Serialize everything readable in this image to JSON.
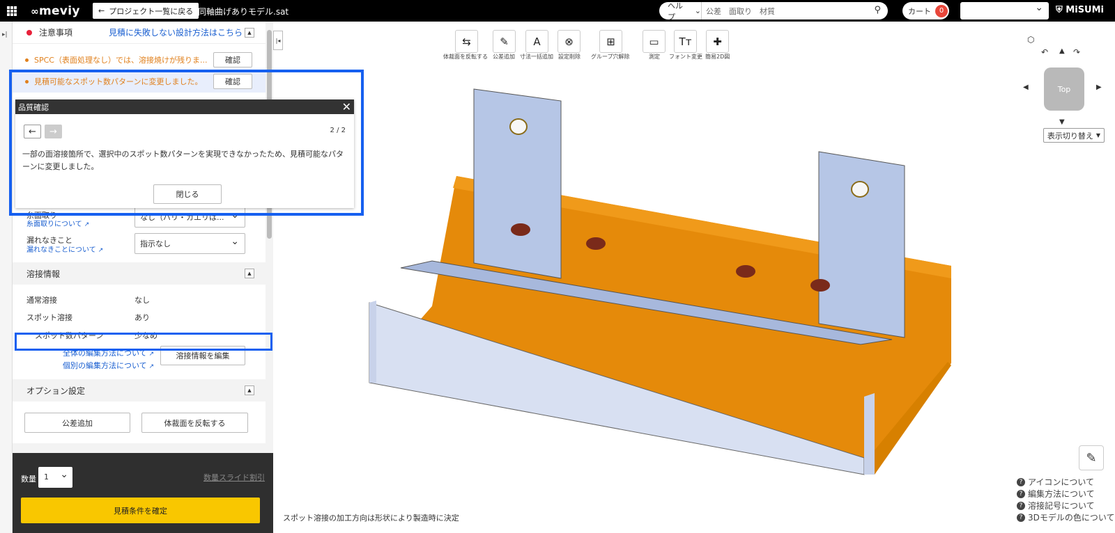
{
  "header": {
    "logo": "meviy",
    "back_label": "プロジェクト一覧に戻る",
    "file_name": "同軸曲げありモデル.sat",
    "help_label": "ヘルプ",
    "search_placeholder": "公差　面取り　材質",
    "cart_label": "カート",
    "cart_count": "0",
    "brand": "MiSUMi"
  },
  "notices": {
    "title": "注意事項",
    "title_link": "見積に失敗しない設計方法はこちら",
    "items": [
      {
        "text": "SPCC（表面処理なし）では、溶接焼けが残りま...",
        "button": "確認"
      },
      {
        "text": "見積可能なスポット数パターンに変更しました。",
        "button": "確認"
      }
    ]
  },
  "modal": {
    "title": "品質確認",
    "page": "2 / 2",
    "message": "一部の面溶接箇所で、選択中のスポット数パターンを実現できなかったため、見積可能なパターンに変更しました。",
    "close_label": "閉じる"
  },
  "fields": [
    {
      "label": "糸面取り",
      "link": "糸面取りについて",
      "value": "なし（バリ・カエリは..."
    },
    {
      "label": "漏れなきこと",
      "link": "漏れなきことについて",
      "value": "指示なし"
    }
  ],
  "welding": {
    "title": "溶接情報",
    "rows": [
      {
        "label": "通常溶接",
        "value": "なし"
      },
      {
        "label": "スポット溶接",
        "value": "あり"
      },
      {
        "label": "スポット数パターン",
        "value": "少なめ"
      }
    ],
    "link1": "全体の編集方法について",
    "link2": "個別の編集方法について",
    "edit_button": "溶接情報を編集"
  },
  "options": {
    "title": "オプション設定",
    "btn1": "公差追加",
    "btn2": "体裁面を反転する"
  },
  "bottom": {
    "qty_label": "数量",
    "qty_value": "1",
    "slide_link": "数量スライド割引",
    "confirm_label": "見積条件を確定"
  },
  "toolbar": [
    {
      "label": "体裁面を反転する",
      "icon": "⇆"
    },
    {
      "label": "公差追加",
      "icon": "✎"
    },
    {
      "label": "寸法一括追加",
      "icon": "A"
    },
    {
      "label": "設定削除",
      "icon": "⊗"
    },
    {
      "label": "グループ穴解除",
      "icon": "⊞"
    },
    {
      "label": "測定",
      "icon": "▭"
    },
    {
      "label": "フォント変更",
      "icon": "Tт"
    },
    {
      "label": "簡易2D図",
      "icon": "✚"
    }
  ],
  "view": {
    "display_toggle": "表示切り替え",
    "cube_label": "Top"
  },
  "help_links": [
    "アイコンについて",
    "編集方法について",
    "溶接記号について",
    "3Dモデルの色について"
  ],
  "footnote": "スポット溶接の加工方向は形状により製造時に決定"
}
